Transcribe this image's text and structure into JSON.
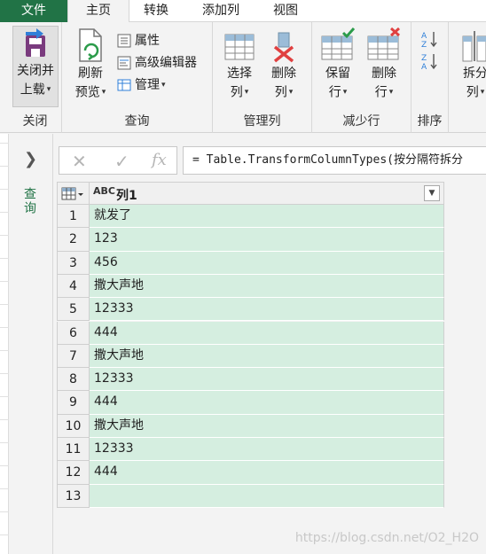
{
  "tabs": [
    {
      "label": "文件"
    },
    {
      "label": "主页"
    },
    {
      "label": "转换"
    },
    {
      "label": "添加列"
    },
    {
      "label": "视图"
    }
  ],
  "ribbon": {
    "close": {
      "btn_line1": "关闭并",
      "btn_line2": "上载",
      "label": "关闭"
    },
    "query": {
      "refresh_line1": "刷新",
      "refresh_line2": "预览",
      "properties": "属性",
      "advanced_editor": "高级编辑器",
      "manage": "管理",
      "label": "查询"
    },
    "manage_columns": {
      "choose_line1": "选择",
      "choose_line2": "列",
      "remove_line1": "删除",
      "remove_line2": "列",
      "label": "管理列"
    },
    "reduce_rows": {
      "keep_line1": "保留",
      "keep_line2": "行",
      "remove_line1": "删除",
      "remove_line2": "行",
      "label": "减少行"
    },
    "sort": {
      "label": "排序"
    },
    "split": {
      "line1": "拆分",
      "line2": "列"
    }
  },
  "queries_pane": {
    "label": "查询"
  },
  "formula_bar": {
    "fx": "fx",
    "formula": "= Table.TransformColumnTypes(按分隔符拆分"
  },
  "grid": {
    "column": {
      "type": "ABC",
      "name": "列1"
    },
    "rows": [
      {
        "num": "1",
        "value": "就发了"
      },
      {
        "num": "2",
        "value": "123"
      },
      {
        "num": "3",
        "value": "456"
      },
      {
        "num": "4",
        "value": "撒大声地"
      },
      {
        "num": "5",
        "value": "12333"
      },
      {
        "num": "6",
        "value": "444"
      },
      {
        "num": "7",
        "value": "撒大声地"
      },
      {
        "num": "8",
        "value": "12333"
      },
      {
        "num": "9",
        "value": "444"
      },
      {
        "num": "10",
        "value": "撒大声地"
      },
      {
        "num": "11",
        "value": "12333"
      },
      {
        "num": "12",
        "value": "444"
      },
      {
        "num": "13",
        "value": ""
      }
    ]
  },
  "watermark": "https://blog.csdn.net/O2_H2O",
  "colors": {
    "file_tab": "#217346",
    "cell_bg": "#d5eee0",
    "delete_red": "#e04040",
    "check_green": "#2b9b4a"
  }
}
